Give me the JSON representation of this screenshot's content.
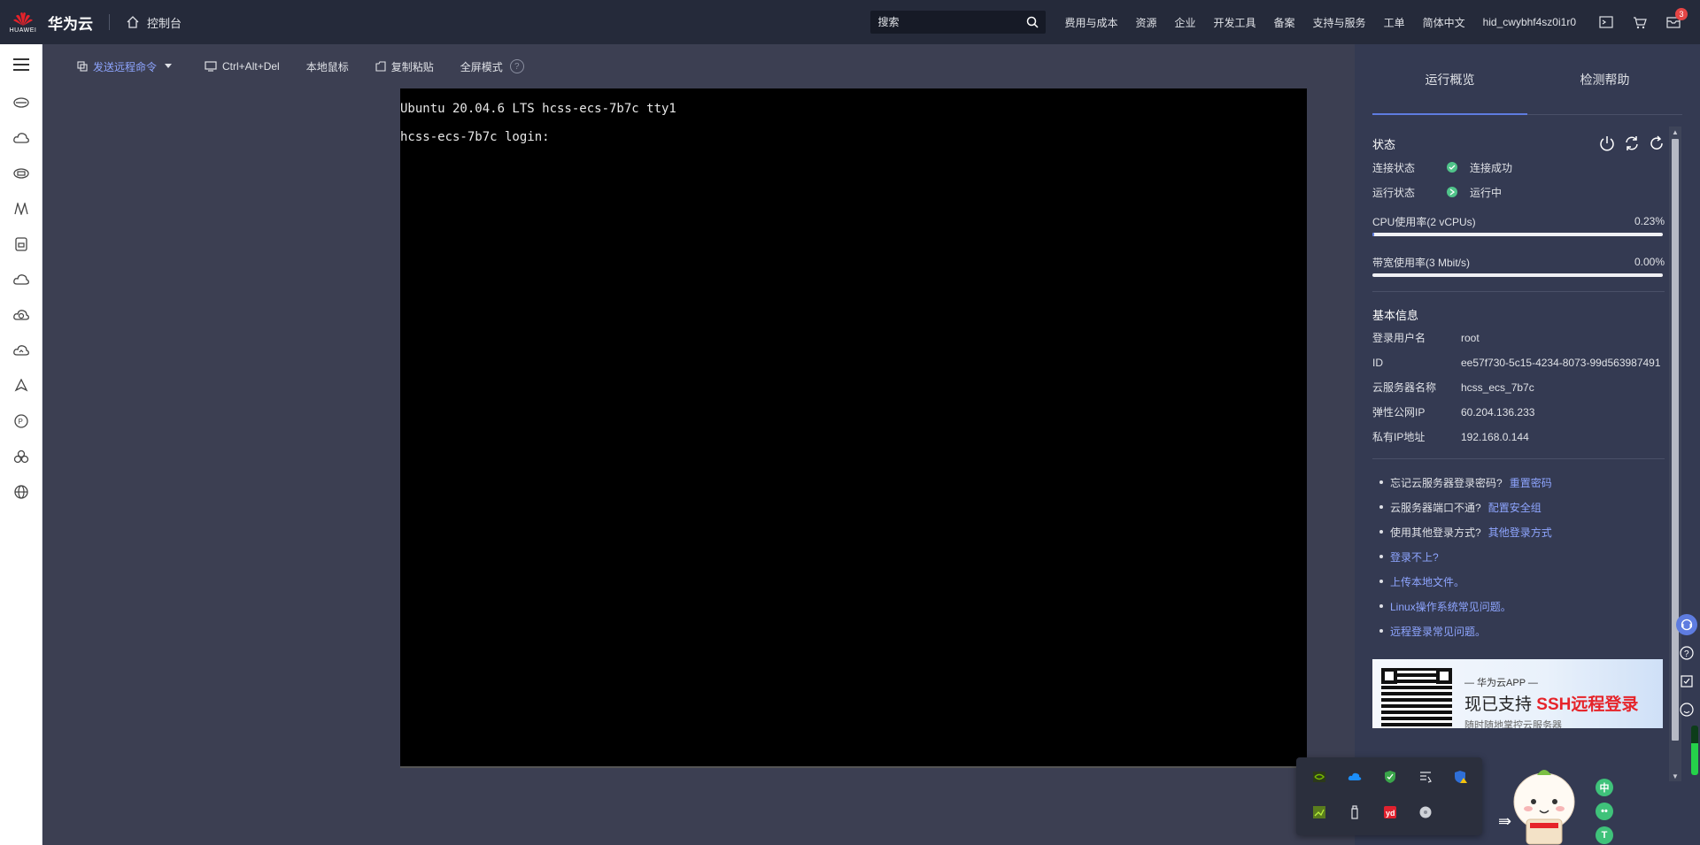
{
  "header": {
    "brand": "华为云",
    "logo_sub": "HUAWEI",
    "console": "控制台",
    "search_placeholder": "搜索",
    "nav": [
      "费用与成本",
      "资源",
      "企业",
      "开发工具",
      "备案",
      "支持与服务",
      "工单",
      "简体中文"
    ],
    "user": "hid_cwybhf4sz0i1r0",
    "notification_count": "3"
  },
  "toolbar": {
    "send_command": "发送远程命令",
    "ctrl_alt_del": "Ctrl+Alt+Del",
    "local_mouse": "本地鼠标",
    "copy_paste": "复制粘贴",
    "fullscreen": "全屏模式",
    "help": "?"
  },
  "terminal": {
    "lines": [
      "Ubuntu 20.04.6 LTS hcss-ecs-7b7c tty1",
      "hcss-ecs-7b7c login: "
    ]
  },
  "panel": {
    "tabs": [
      "运行概览",
      "检测帮助"
    ],
    "status_title": "状态",
    "connection_label": "连接状态",
    "connection_value": "连接成功",
    "run_label": "运行状态",
    "run_value": "运行中",
    "cpu_label": "CPU使用率(2 vCPUs)",
    "cpu_value": "0.23%",
    "cpu_fraction": 0.0023,
    "bw_label": "带宽使用率(3 Mbit/s)",
    "bw_value": "0.00%",
    "bw_fraction": 0.0,
    "basic_title": "基本信息",
    "info": [
      {
        "label": "登录用户名",
        "value": "root"
      },
      {
        "label": "ID",
        "value": "ee57f730-5c15-4234-8073-99d563987491"
      },
      {
        "label": "云服务器名称",
        "value": "hcss_ecs_7b7c"
      },
      {
        "label": "弹性公网IP",
        "value": "60.204.136.233"
      },
      {
        "label": "私有IP地址",
        "value": "192.168.0.144"
      }
    ],
    "tips": [
      {
        "text": "忘记云服务器登录密码?",
        "link": "重置密码"
      },
      {
        "text": "云服务器端口不通?",
        "link": "配置安全组"
      },
      {
        "text": "使用其他登录方式?",
        "link": "其他登录方式"
      },
      {
        "text": "",
        "link": "登录不上?"
      },
      {
        "text": "",
        "link": "上传本地文件。"
      },
      {
        "text": "",
        "link": "Linux操作系统常见问题。"
      },
      {
        "text": "",
        "link": "远程登录常见问题。"
      }
    ],
    "banner": {
      "app": "— 华为云APP —",
      "head_prefix": "现已支持 ",
      "head_highlight": "SSH远程登录",
      "sub": "随时随地掌控云服务器"
    }
  },
  "tray": {
    "icons": [
      "nvidia-icon",
      "cloud-icon",
      "shield-icon",
      "media-icon",
      "defender-warning-icon",
      "nvidia-settings-icon",
      "usb-icon",
      "youdao-icon",
      "disk-icon"
    ]
  },
  "colors": {
    "header_bg": "#252a3a",
    "page_bg": "#3c3f52",
    "panel_bg": "#343a52",
    "accent": "#5e7ce0",
    "link": "#8ea5ff",
    "status_ok": "#50c48a"
  }
}
